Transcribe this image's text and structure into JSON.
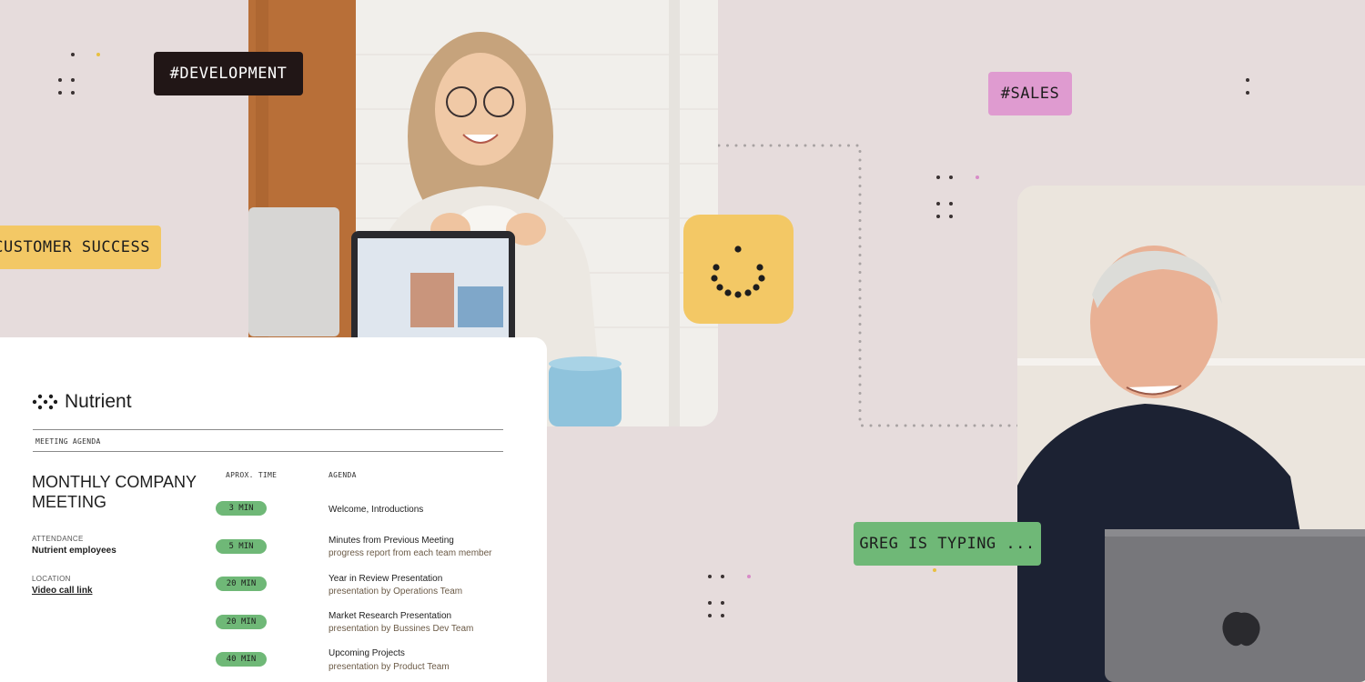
{
  "tags": {
    "development": "#DEVELOPMENT",
    "sales": "#SALES",
    "customer_success": "#CUSTOMER SUCCESS",
    "typing": "GREG IS TYPING ..."
  },
  "brand": {
    "name": "Nutrient"
  },
  "document": {
    "header": "MEETING AGENDA",
    "title": "MONTHLY COMPANY MEETING",
    "attendance_label": "ATTENDANCE",
    "attendance_value": "Nutrient employees",
    "location_label": "LOCATION",
    "location_value": "Video call link",
    "time_header": "APROX. TIME",
    "agenda_header": "AGENDA",
    "items": [
      {
        "time": "3 MIN",
        "title": "Welcome, Introductions",
        "sub": ""
      },
      {
        "time": "5 MIN",
        "title": "Minutes from Previous Meeting",
        "sub": "progress report from each team member"
      },
      {
        "time": "20 MIN",
        "title": "Year in Review Presentation",
        "sub": "presentation by Operations Team"
      },
      {
        "time": "20 MIN",
        "title": "Market Research Presentation",
        "sub": "presentation by Bussines Dev Team"
      },
      {
        "time": "40 MIN",
        "title": "Upcoming Projects",
        "sub": "presentation by Product Team"
      }
    ]
  },
  "colors": {
    "background": "#e6dcdc",
    "tag_dark": "#211616",
    "tag_pink": "#df9bd0",
    "tag_yellow": "#f3c865",
    "tag_green": "#6fb877"
  },
  "icons": {
    "loader": "loading-spinner-icon",
    "logo": "nutrient-logo-icon"
  }
}
